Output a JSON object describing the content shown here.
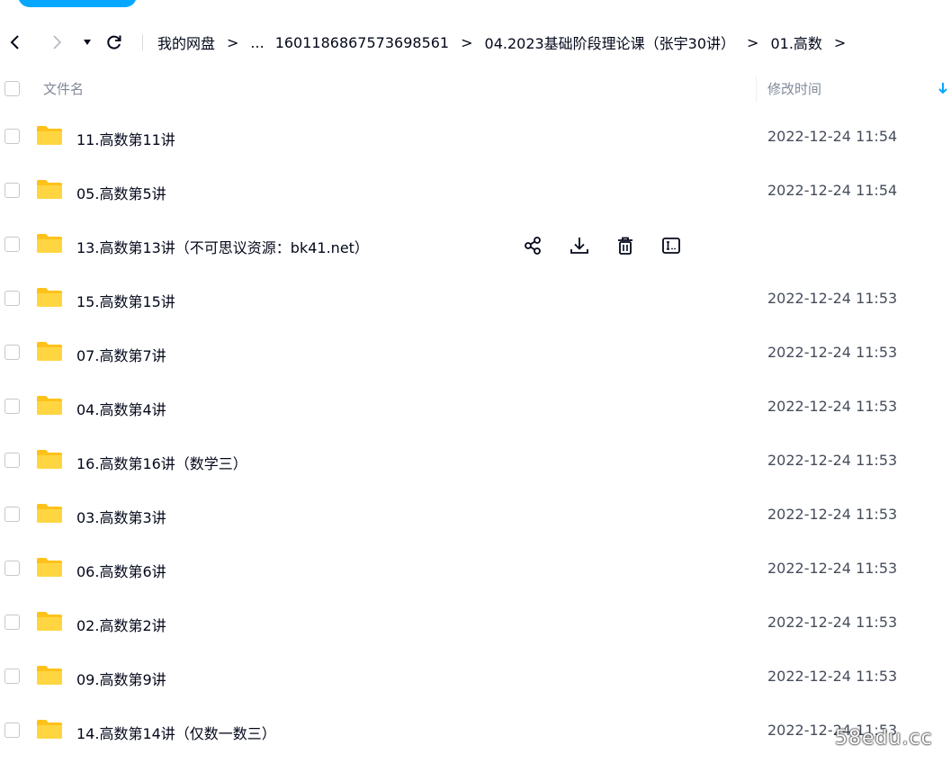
{
  "breadcrumb": [
    "我的网盘",
    "...",
    "1601186867573698561",
    "04.2023基础阶段理论课（张宇30讲）",
    "01.高数"
  ],
  "crumb_separator": ">",
  "header": {
    "name_label": "文件名",
    "time_label": "修改时间"
  },
  "files": [
    {
      "name": "11.高数第11讲",
      "time": "2022-12-24 11:54"
    },
    {
      "name": "05.高数第5讲",
      "time": "2022-12-24 11:54"
    },
    {
      "name": "13.高数第13讲（不可思议资源：bk41.net）",
      "time": ""
    },
    {
      "name": "15.高数第15讲",
      "time": "2022-12-24 11:53"
    },
    {
      "name": "07.高数第7讲",
      "time": "2022-12-24 11:53"
    },
    {
      "name": "04.高数第4讲",
      "time": "2022-12-24 11:53"
    },
    {
      "name": "16.高数第16讲（数学三）",
      "time": "2022-12-24 11:53"
    },
    {
      "name": "03.高数第3讲",
      "time": "2022-12-24 11:53"
    },
    {
      "name": "06.高数第6讲",
      "time": "2022-12-24 11:53"
    },
    {
      "name": "02.高数第2讲",
      "time": "2022-12-24 11:53"
    },
    {
      "name": "09.高数第9讲",
      "time": "2022-12-24 11:53"
    },
    {
      "name": "14.高数第14讲（仅数一数三）",
      "time": "2022-12-24 11:53"
    }
  ],
  "hover_actions": [
    "share-icon",
    "download-icon",
    "delete-icon",
    "rename-icon"
  ],
  "watermark": "58edu.cc",
  "colors": {
    "accent": "#06a7ff",
    "folder": "#ffcf33",
    "sort_arrow": "#06a7ff"
  }
}
